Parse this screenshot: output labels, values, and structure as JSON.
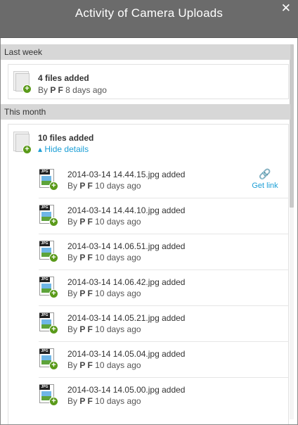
{
  "window": {
    "title": "Activity of Camera Uploads",
    "close_glyph": "✕"
  },
  "sections": {
    "last_week": {
      "label": "Last week",
      "headline": "4 files added",
      "by_prefix": "By",
      "user": "P F",
      "when": "8 days ago"
    },
    "this_month": {
      "label": "This month",
      "headline": "10 files added",
      "hide_details": "Hide details",
      "hide_glyph": "▴",
      "files": [
        {
          "name": "2014-03-14 14.44.15.jpg added",
          "by_prefix": "By",
          "user": "P F",
          "when": "10 days ago"
        },
        {
          "name": "2014-03-14 14.44.10.jpg added",
          "by_prefix": "By",
          "user": "P F",
          "when": "10 days ago"
        },
        {
          "name": "2014-03-14 14.06.51.jpg added",
          "by_prefix": "By",
          "user": "P F",
          "when": "10 days ago"
        },
        {
          "name": "2014-03-14 14.06.42.jpg added",
          "by_prefix": "By",
          "user": "P F",
          "when": "10 days ago"
        },
        {
          "name": "2014-03-14 14.05.21.jpg added",
          "by_prefix": "By",
          "user": "P F",
          "when": "10 days ago"
        },
        {
          "name": "2014-03-14 14.05.04.jpg added",
          "by_prefix": "By",
          "user": "P F",
          "when": "10 days ago"
        },
        {
          "name": "2014-03-14 14.05.00.jpg added",
          "by_prefix": "By",
          "user": "P F",
          "when": "10 days ago"
        }
      ],
      "get_link": {
        "label": "Get link",
        "icon": "link-icon",
        "glyph": "🔗"
      }
    }
  },
  "icons": {
    "file_badge": "+",
    "jpg_tag": "JPG"
  },
  "colors": {
    "titlebar": "#6b6b6b",
    "section_band": "#d7d7d7",
    "link_blue": "#1c9fd6",
    "badge_green": "#5a9a1a"
  }
}
